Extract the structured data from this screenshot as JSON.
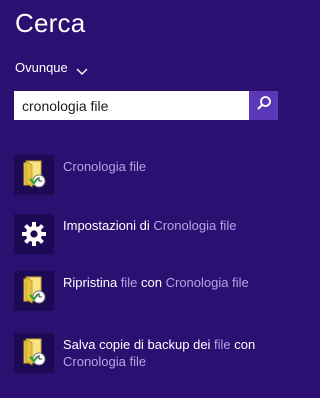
{
  "header": {
    "title": "Cerca"
  },
  "scope": {
    "label": "Ovunque",
    "icon": "chevron-down-icon"
  },
  "search": {
    "value": "cronologia file",
    "button_icon": "search-icon"
  },
  "results": [
    {
      "icon": "file-history-icon",
      "parts": [
        {
          "text": "Cronologia file",
          "emph": false
        }
      ]
    },
    {
      "icon": "gear-icon",
      "parts": [
        {
          "text": "Impostazioni di ",
          "emph": true
        },
        {
          "text": "Cronologia file",
          "emph": false
        }
      ]
    },
    {
      "icon": "file-history-icon",
      "parts": [
        {
          "text": "Ripristina ",
          "emph": true
        },
        {
          "text": "file",
          "emph": false
        },
        {
          "text": " con ",
          "emph": true
        },
        {
          "text": "Cronologia file",
          "emph": false
        }
      ]
    },
    {
      "icon": "file-history-icon",
      "parts": [
        {
          "text": "Salva copie di backup dei ",
          "emph": true
        },
        {
          "text": "file",
          "emph": false
        },
        {
          "text": " con ",
          "emph": true
        },
        {
          "text": "Cronologia file",
          "emph": false
        }
      ]
    }
  ],
  "colors": {
    "background": "#2b0f71",
    "search_button": "#5a38b8",
    "highlight_text": "#ffffff",
    "muted_text": "#b3a6e6"
  }
}
